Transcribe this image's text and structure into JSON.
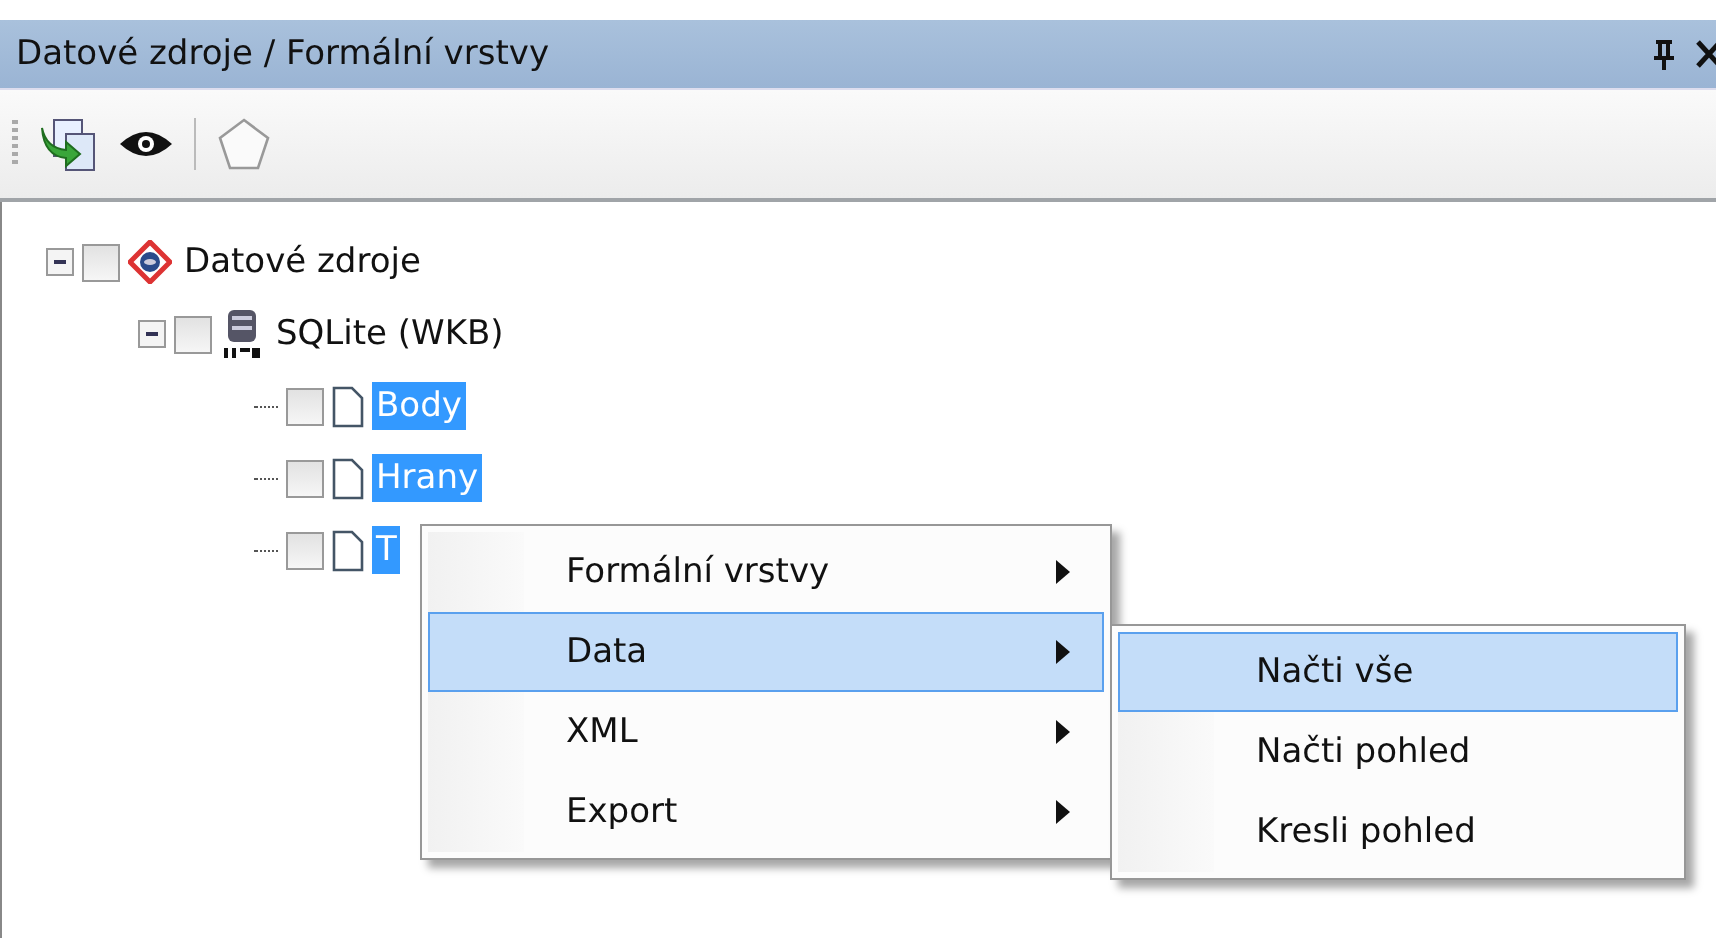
{
  "panel": {
    "title": "Datové zdroje / Formální vrstvy"
  },
  "tree": [
    {
      "label": "Datové zdroje",
      "kind": "root",
      "expanded": true,
      "checked": false,
      "selected": false,
      "children": [
        {
          "label": "SQLite (WKB)",
          "kind": "database",
          "expanded": true,
          "checked": false,
          "selected": false,
          "children": [
            {
              "label": "Body",
              "kind": "layer",
              "checked": false,
              "selected": true
            },
            {
              "label": "Hrany",
              "kind": "layer",
              "checked": false,
              "selected": true
            },
            {
              "label": "T",
              "kind": "layer",
              "checked": false,
              "selected": true
            }
          ]
        }
      ]
    }
  ],
  "context_menu": {
    "items": [
      {
        "label": "Formální vrstvy",
        "selected": false
      },
      {
        "label": "Data",
        "selected": true
      },
      {
        "label": "XML",
        "selected": false
      },
      {
        "label": "Export",
        "selected": false
      }
    ]
  },
  "submenu": {
    "items": [
      {
        "label": "Načti vše",
        "selected": true
      },
      {
        "label": "Načti pohled",
        "selected": false
      },
      {
        "label": "Kresli pohled",
        "selected": false
      }
    ]
  }
}
